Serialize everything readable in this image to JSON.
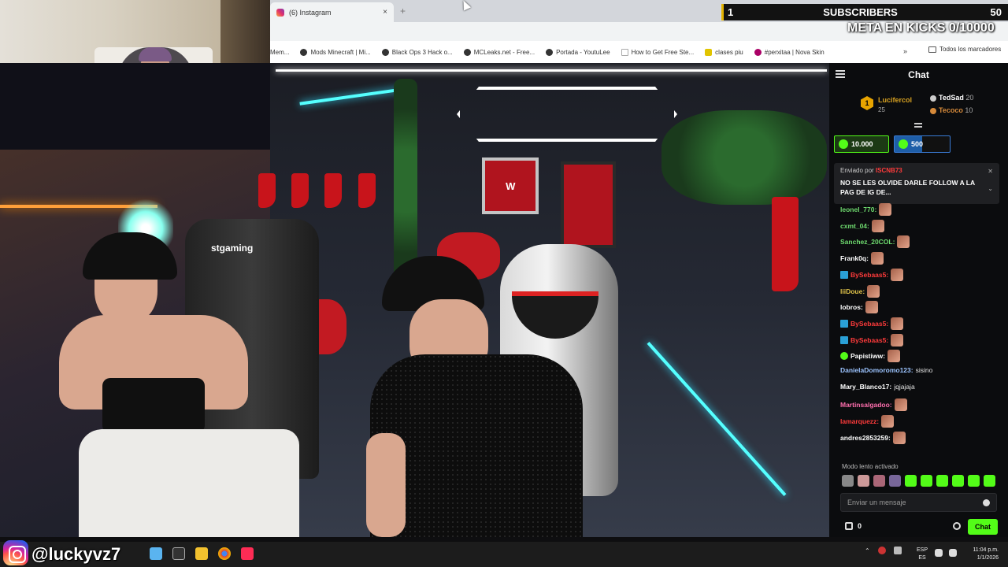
{
  "browser": {
    "tab_title": "(6) Instagram",
    "tab_close": "×",
    "new_tab": "+",
    "bookmarks": [
      {
        "label": "Mem...",
        "icon": "none"
      },
      {
        "label": "Mods Minecraft | Mi...",
        "icon": "dark"
      },
      {
        "label": "Black Ops 3 Hack o...",
        "icon": "dark"
      },
      {
        "label": "MCLeaks.net - Free...",
        "icon": "dark"
      },
      {
        "label": "Portada - YoutuLee",
        "icon": "dark"
      },
      {
        "label": "How to Get Free Ste...",
        "icon": "white"
      },
      {
        "label": "clases piu",
        "icon": "yellow"
      },
      {
        "label": "#perxitaa | Nova Skin",
        "icon": "pink"
      }
    ],
    "bookmarks_more": "»",
    "all_bookmarks": "Todos los marcadores"
  },
  "overlay": {
    "sub_count": "1",
    "sub_label": "SUBSCRIBERS",
    "sub_goal": "50",
    "meta_text": "META EN KICKS 0/10000"
  },
  "video": {
    "chair_brand": "stgaming"
  },
  "chat": {
    "title": "Chat",
    "leaderboard": [
      {
        "rank": "1",
        "name": "Lucifercol",
        "count": "25"
      },
      {
        "name": "TedSad",
        "count": "20"
      },
      {
        "name": "Tecoco",
        "count": "10"
      }
    ],
    "goals": [
      {
        "value": "10.000"
      },
      {
        "value": "500"
      }
    ],
    "pinned": {
      "sent_by": "Enviado por",
      "author": "ISCNB73",
      "message": "NO SE LES OLVIDE DARLE FOLLOW A LA PAG DE IG DE..."
    },
    "messages": [
      {
        "user": "leonel_770:",
        "text": "",
        "color": "#6fdc6f",
        "emote": true,
        "badge": ""
      },
      {
        "user": "cxmt_04:",
        "text": "",
        "color": "#6fdc6f",
        "emote": true,
        "badge": ""
      },
      {
        "user": "Sanchez_20COL:",
        "text": "",
        "color": "#6fdc6f",
        "emote": true,
        "badge": ""
      },
      {
        "user": "Frank0q:",
        "text": "",
        "color": "#ffffff",
        "emote": true,
        "badge": ""
      },
      {
        "user": "BySebaas5:",
        "text": "",
        "color": "#ff3b3b",
        "emote": true,
        "badge": "blue"
      },
      {
        "user": "liiDoue:",
        "text": "",
        "color": "#e0c34a",
        "emote": true,
        "badge": ""
      },
      {
        "user": "lobros:",
        "text": "",
        "color": "#ffffff",
        "emote": true,
        "badge": ""
      },
      {
        "user": "BySebaas5:",
        "text": "",
        "color": "#ff3b3b",
        "emote": true,
        "badge": "blue"
      },
      {
        "user": "BySebaas5:",
        "text": "",
        "color": "#ff3b3b",
        "emote": true,
        "badge": "blue"
      },
      {
        "user": "Papistiww:",
        "text": "",
        "color": "#ffffff",
        "emote": true,
        "badge": "green"
      },
      {
        "user": "DanielaDomoromo123:",
        "text": "sisino",
        "color": "#9cc4ff",
        "emote": false,
        "badge": ""
      },
      {
        "user": "Mary_Blanco17:",
        "text": "jqjajaja",
        "color": "#ffffff",
        "emote": false,
        "badge": ""
      },
      {
        "user": "Martinsalgadoo:",
        "text": "",
        "color": "#ff6fae",
        "emote": true,
        "badge": ""
      },
      {
        "user": "lamarquezz:",
        "text": "",
        "color": "#ff3b3b",
        "emote": true,
        "badge": ""
      },
      {
        "user": "andres2853259:",
        "text": "",
        "color": "#ffffff",
        "emote": true,
        "badge": ""
      }
    ],
    "slow_mode": "Modo lento activado",
    "input_placeholder": "Enviar un mensaje",
    "footer_count": "0",
    "chat_button": "Chat"
  },
  "taskbar": {
    "handle": "@luckyvz7",
    "lang_top": "ESP",
    "lang_bottom": "ES",
    "time": "11:04 p.m.",
    "date": "1/1/2026"
  },
  "colors": {
    "kick_green": "#53fc18",
    "overlay_accent": "#e5b400"
  }
}
